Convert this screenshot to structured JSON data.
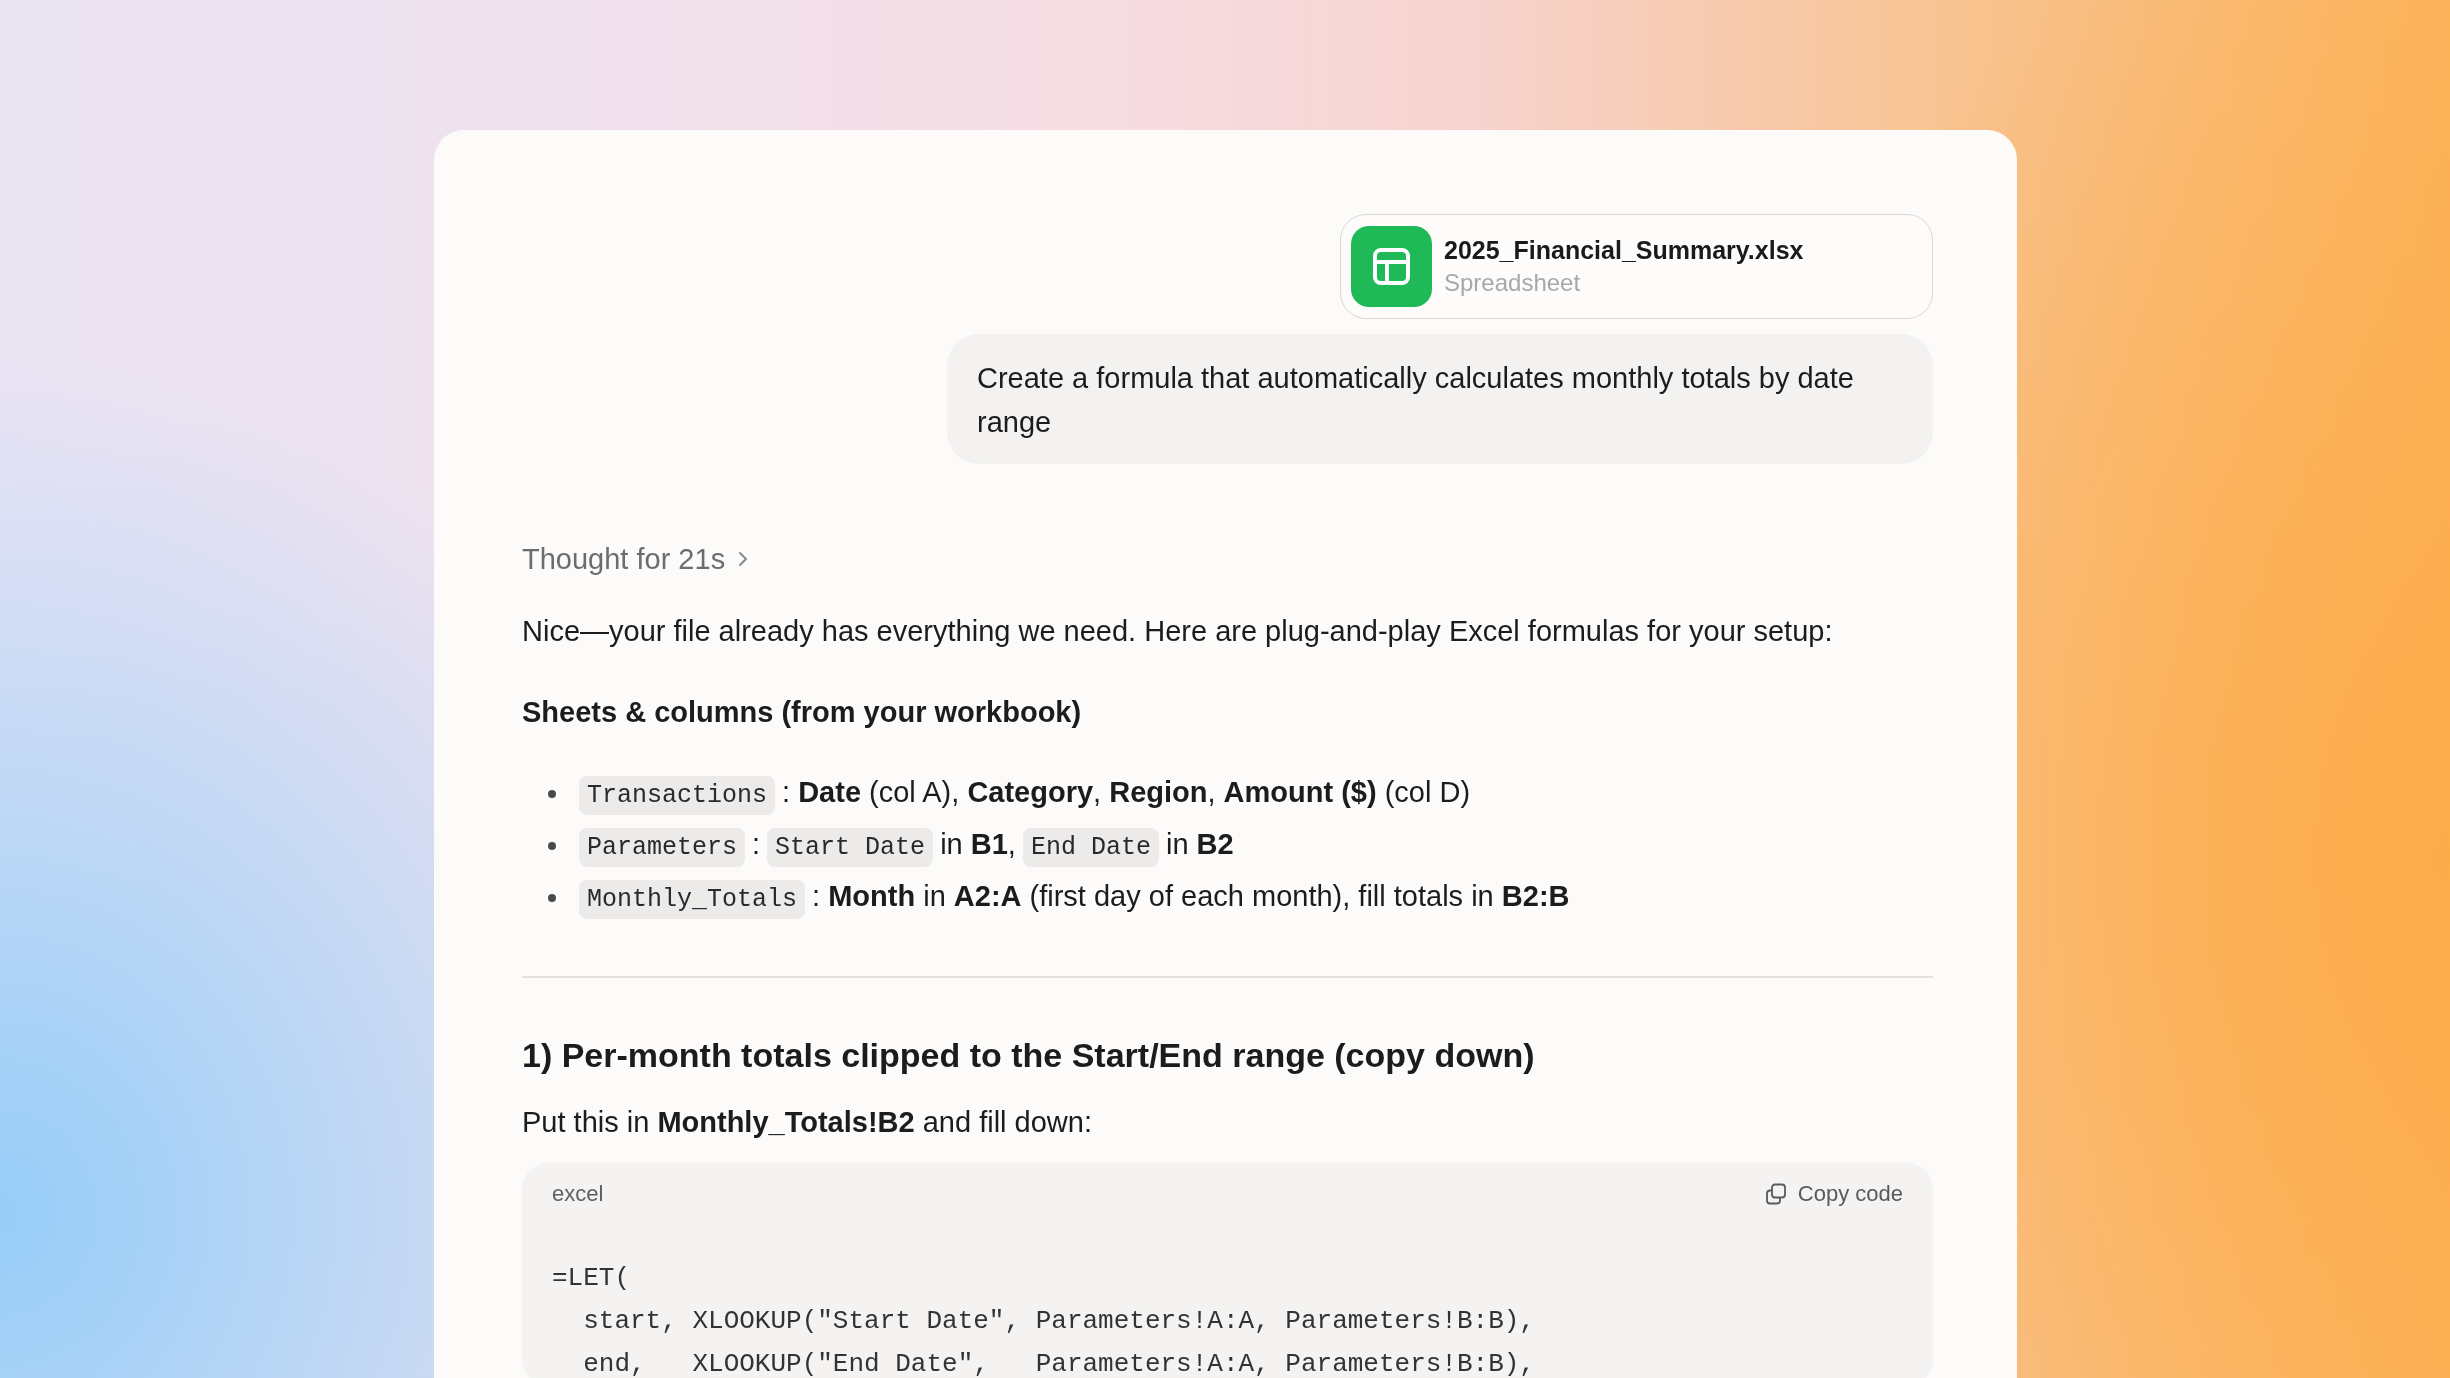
{
  "attachment": {
    "filename": "2025_Financial_Summary.xlsx",
    "type": "Spreadsheet"
  },
  "user_message": "Create a formula that automatically calculates monthly totals by date range",
  "assistant": {
    "thought": {
      "label": "Thought for 21s",
      "expanded": false
    },
    "intro": "Nice—your file already has everything we need. Here are plug-and-play Excel formulas for your setup:",
    "sheets_heading": "Sheets & columns (from your workbook)",
    "bullets": [
      {
        "parts": [
          {
            "kind": "code",
            "text": "Transactions"
          },
          {
            "kind": "text",
            "text": ": **Date** (col A), **Category**, **Region**, **Amount ($)** (col D)"
          }
        ]
      },
      {
        "parts": [
          {
            "kind": "code",
            "text": "Parameters"
          },
          {
            "kind": "text",
            "text": ":"
          },
          {
            "kind": "code",
            "text": "Start Date"
          },
          {
            "kind": "text",
            "text": "in **B1**,"
          },
          {
            "kind": "code",
            "text": "End Date"
          },
          {
            "kind": "text",
            "text": "in **B2**"
          }
        ]
      },
      {
        "parts": [
          {
            "kind": "code",
            "text": "Monthly_Totals"
          },
          {
            "kind": "text",
            "text": ": **Month** in **A2:A** (first day of each month), fill totals in **B2:B**"
          }
        ]
      }
    ],
    "section_heading": "1) Per-month totals clipped to the Start/End range (copy down)",
    "instruction": "Put this in **Monthly_Totals!B2** and fill down:",
    "code_block": {
      "language": "excel",
      "copy_label": "Copy code",
      "lines": [
        "=LET(",
        "  start, XLOOKUP(\"Start Date\", Parameters!A:A, Parameters!B:B),",
        "  end,   XLOOKUP(\"End Date\",   Parameters!A:A, Parameters!B:B),"
      ]
    }
  }
}
